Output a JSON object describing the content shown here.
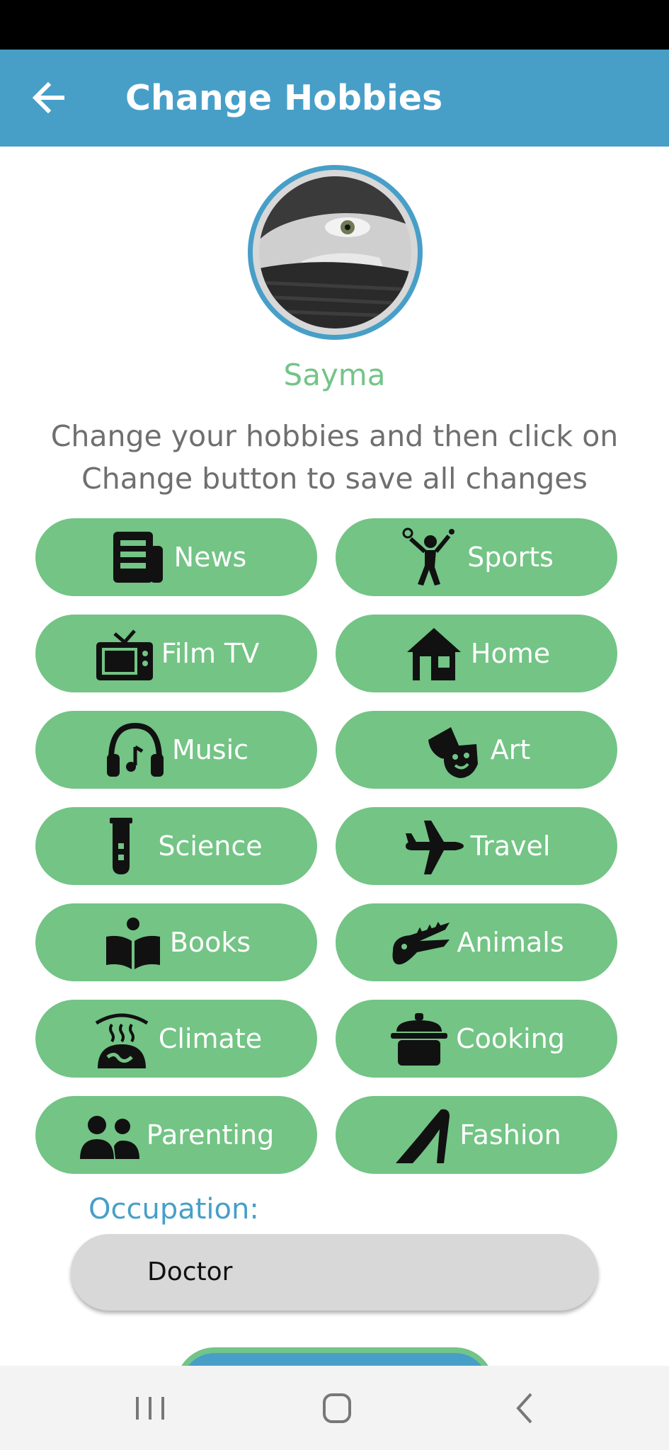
{
  "app_bar": {
    "title": "Change Hobbies"
  },
  "profile": {
    "name": "Sayma"
  },
  "instructions": "Change your hobbies and then click on Change button to save all changes",
  "hobbies": [
    {
      "label": "News",
      "icon": "newspaper-icon"
    },
    {
      "label": "Sports",
      "icon": "tennis-player-icon"
    },
    {
      "label": "Film TV",
      "icon": "tv-icon"
    },
    {
      "label": "Home",
      "icon": "house-icon"
    },
    {
      "label": "Music",
      "icon": "headphones-icon"
    },
    {
      "label": "Art",
      "icon": "theater-mask-icon"
    },
    {
      "label": "Science",
      "icon": "test-tube-icon"
    },
    {
      "label": "Travel",
      "icon": "airplane-icon"
    },
    {
      "label": "Books",
      "icon": "reader-icon"
    },
    {
      "label": "Animals",
      "icon": "crocodile-icon"
    },
    {
      "label": "Climate",
      "icon": "earth-heat-icon"
    },
    {
      "label": "Cooking",
      "icon": "cooking-pot-icon"
    },
    {
      "label": "Parenting",
      "icon": "user-group-icon"
    },
    {
      "label": "Fashion",
      "icon": "high-heel-icon"
    }
  ],
  "occupation": {
    "label": "Occupation:",
    "value": "Doctor"
  },
  "colors": {
    "primary": "#479fc8",
    "accent": "#73c485",
    "field": "#d8d8d8"
  }
}
